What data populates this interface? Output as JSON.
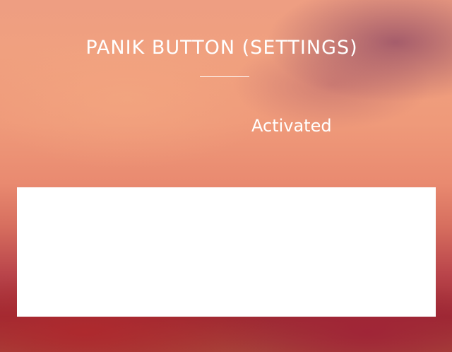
{
  "page": {
    "title": "PANIK BUTTON (SETTINGS)",
    "status_text": "Activated"
  },
  "colors": {
    "text": "#ffffff",
    "panel": "#ffffff",
    "background_top": "#ee9e82",
    "background_bottom": "#9d2a33"
  }
}
